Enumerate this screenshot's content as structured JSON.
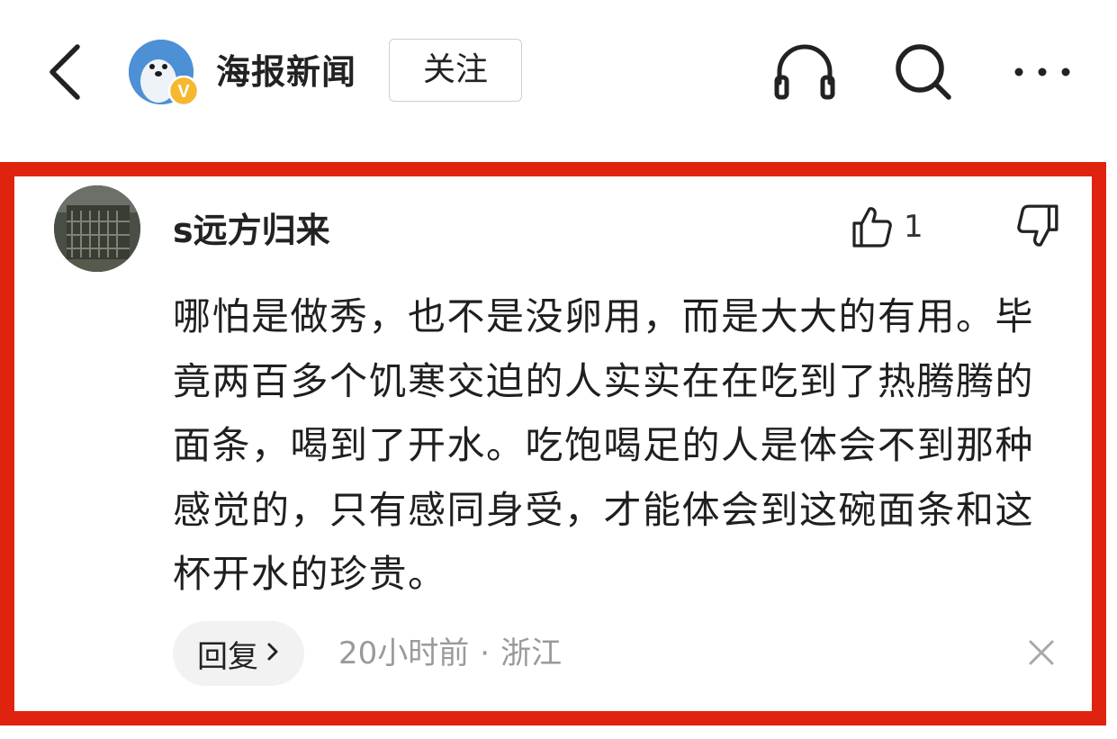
{
  "header": {
    "channel_name": "海报新闻",
    "follow_label": "关注",
    "icons": {
      "back": "back-arrow-icon",
      "verified": "verified-badge-icon",
      "listen": "headphones-icon",
      "search": "search-icon",
      "more": "more-icon"
    },
    "verified_badge_text": "V"
  },
  "comment": {
    "username": "s远方归来",
    "like_count": "1",
    "text": "哪怕是做秀，也不是没卵用，而是大大的有用。毕竟两百多个饥寒交迫的人实实在在吃到了热腾腾的面条，喝到了开水。吃饱喝足的人是体会不到那种感觉的，只有感同身受，才能体会到这碗面条和这杯开水的珍贵。",
    "reply_label": "回复",
    "time": "20小时前",
    "separator": "·",
    "location": "浙江",
    "icons": {
      "like": "thumbs-up-icon",
      "dislike": "thumbs-down-icon",
      "reply_chevron": "chevron-right-icon",
      "close": "close-icon"
    }
  },
  "colors": {
    "highlight_border": "#e0230e",
    "channel_avatar": "#4d90d6",
    "verified_badge": "#f5b82e",
    "meta_text": "#9a9a9a",
    "reply_bg": "#f2f2f2"
  }
}
